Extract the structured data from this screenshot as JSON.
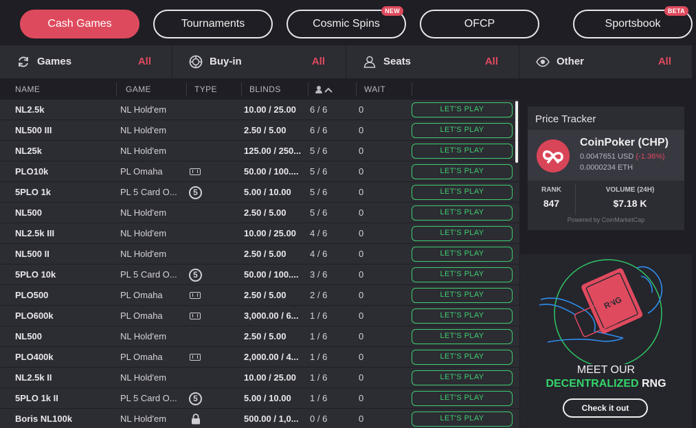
{
  "tabs": [
    {
      "label": "Cash Games",
      "active": true,
      "badge": ""
    },
    {
      "label": "Tournaments",
      "active": false,
      "badge": ""
    },
    {
      "label": "Cosmic Spins",
      "active": false,
      "badge": "NEW"
    },
    {
      "label": "OFCP",
      "active": false,
      "badge": ""
    },
    {
      "label": "Sportsbook",
      "active": false,
      "badge": "BETA"
    }
  ],
  "filters": [
    {
      "label": "Games",
      "value": "All",
      "icon": "refresh-icon"
    },
    {
      "label": "Buy-in",
      "value": "All",
      "icon": "chip-icon"
    },
    {
      "label": "Seats",
      "value": "All",
      "icon": "user-icon"
    },
    {
      "label": "Other",
      "value": "All",
      "icon": "eye-icon"
    }
  ],
  "table": {
    "headers": {
      "name": "NAME",
      "game": "GAME",
      "type": "TYPE",
      "blinds": "BLINDS",
      "wait": "WAIT"
    },
    "play_label": "LET'S PLAY",
    "rows": [
      {
        "name": "NL2.5k",
        "game": "NL  Hold'em",
        "type": "",
        "blinds": "10.00 / 25.00",
        "seats": "6 / 6",
        "wait": "0"
      },
      {
        "name": "NL500 III",
        "game": "NL  Hold'em",
        "type": "",
        "blinds": "2.50 / 5.00",
        "seats": "6 / 6",
        "wait": "0"
      },
      {
        "name": "NL25k",
        "game": "NL  Hold'em",
        "type": "",
        "blinds": "125.00 / 250...",
        "seats": "5 / 6",
        "wait": "0"
      },
      {
        "name": "PLO10k",
        "game": "PL  Omaha",
        "type": "omaha-icon",
        "blinds": "50.00 / 100....",
        "seats": "5 / 6",
        "wait": "0"
      },
      {
        "name": "5PLO 1k",
        "game": "PL  5 Card O...",
        "type": "five-card-icon",
        "blinds": "5.00 / 10.00",
        "seats": "5 / 6",
        "wait": "0"
      },
      {
        "name": "NL500",
        "game": "NL  Hold'em",
        "type": "",
        "blinds": "2.50 / 5.00",
        "seats": "5 / 6",
        "wait": "0"
      },
      {
        "name": "NL2.5k III",
        "game": "NL  Hold'em",
        "type": "",
        "blinds": "10.00 / 25.00",
        "seats": "4 / 6",
        "wait": "0"
      },
      {
        "name": "NL500 II",
        "game": "NL  Hold'em",
        "type": "",
        "blinds": "2.50 / 5.00",
        "seats": "4 / 6",
        "wait": "0"
      },
      {
        "name": "5PLO 10k",
        "game": "PL  5 Card O...",
        "type": "five-card-icon",
        "blinds": "50.00 / 100....",
        "seats": "3 / 6",
        "wait": "0"
      },
      {
        "name": "PLO500",
        "game": "PL  Omaha",
        "type": "omaha-icon",
        "blinds": "2.50 / 5.00",
        "seats": "2 / 6",
        "wait": "0"
      },
      {
        "name": "PLO600k",
        "game": "PL  Omaha",
        "type": "omaha-icon",
        "blinds": "3,000.00 / 6...",
        "seats": "1 / 6",
        "wait": "0"
      },
      {
        "name": "NL500",
        "game": "NL  Hold'em",
        "type": "",
        "blinds": "2.50 / 5.00",
        "seats": "1 / 6",
        "wait": "0"
      },
      {
        "name": "PLO400k",
        "game": "PL  Omaha",
        "type": "omaha-icon",
        "blinds": "2,000.00 / 4...",
        "seats": "1 / 6",
        "wait": "0"
      },
      {
        "name": "NL2.5k II",
        "game": "NL  Hold'em",
        "type": "",
        "blinds": "10.00 / 25.00",
        "seats": "1 / 6",
        "wait": "0"
      },
      {
        "name": "5PLO 1k II",
        "game": "PL  5 Card O...",
        "type": "five-card-icon",
        "blinds": "5.00 / 10.00",
        "seats": "1 / 6",
        "wait": "0"
      },
      {
        "name": "Boris NL100k",
        "game": "NL  Hold'em",
        "type": "lock-icon",
        "blinds": "500.00 / 1,0...",
        "seats": "0 / 6",
        "wait": "0"
      }
    ]
  },
  "tracker": {
    "title": "Price Tracker",
    "coin": "CoinPoker (CHP)",
    "usd": "0.0047651 USD",
    "change": "(-1.36%)",
    "eth": "0.0000234 ETH",
    "rank_label": "RANK",
    "rank": "847",
    "volume_label": "VOLUME (24H)",
    "volume": "$7.18 K",
    "powered": "Powered by CoinMarketCap"
  },
  "promo": {
    "line1": "MEET OUR",
    "line2_green": "DECENTRALIZED",
    "line2_white": "RNG",
    "card_text": "RNG",
    "button": "Check it out"
  },
  "colors": {
    "accent": "#de4a5d",
    "play": "#3fcf6f",
    "panel": "#2c2c33",
    "bg": "#1e1e24"
  }
}
